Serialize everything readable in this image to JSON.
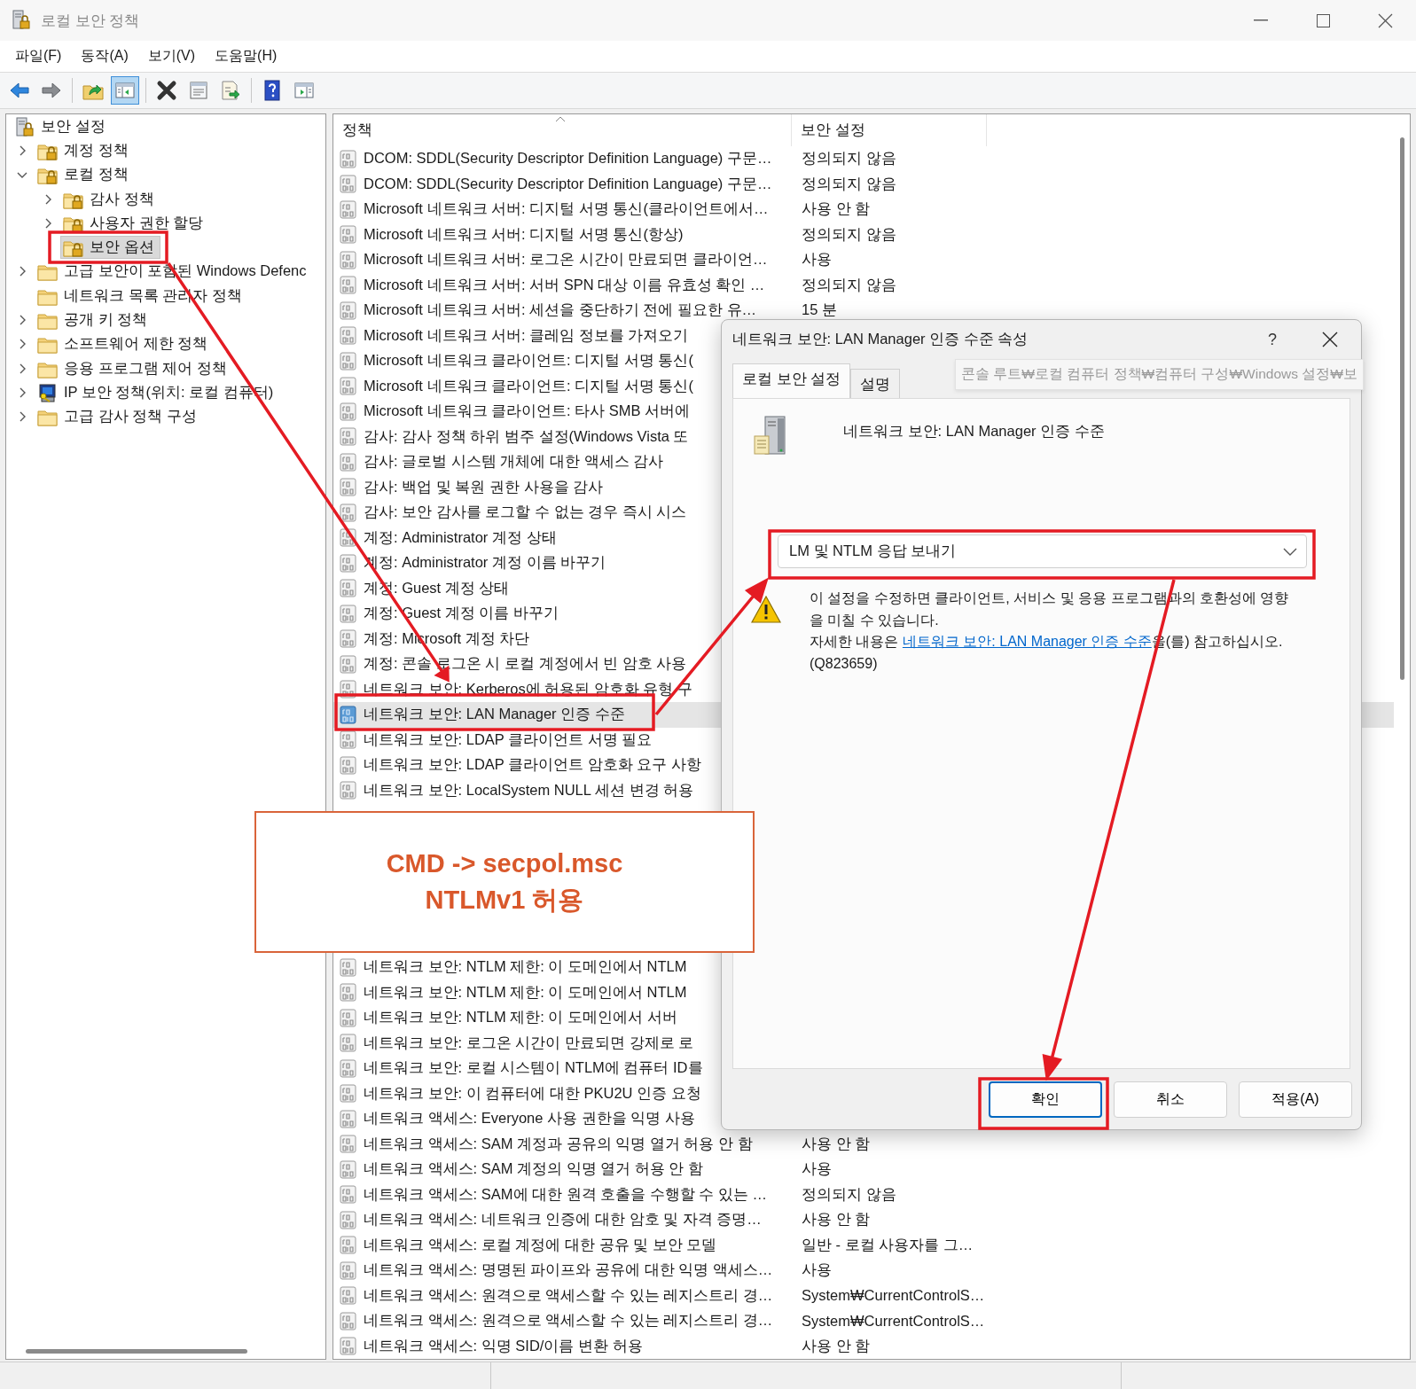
{
  "window": {
    "title": "로컬 보안 정책"
  },
  "menu": [
    "파일(F)",
    "동작(A)",
    "보기(V)",
    "도움말(H)"
  ],
  "toolbar": [
    [
      {
        "kind": "back",
        "pressed": false
      },
      {
        "kind": "forward",
        "pressed": false
      }
    ],
    [
      {
        "kind": "up",
        "pressed": false
      },
      {
        "kind": "tree",
        "pressed": true
      }
    ],
    [
      {
        "kind": "delete",
        "pressed": false
      },
      {
        "kind": "properties",
        "pressed": false
      },
      {
        "kind": "export",
        "pressed": false
      }
    ],
    [
      {
        "kind": "help",
        "pressed": false
      },
      {
        "kind": "pane",
        "pressed": false
      }
    ]
  ],
  "tree": {
    "label": "보안 설정",
    "kind": "server-lock",
    "selected": false,
    "children": [
      {
        "label": "계정 정책",
        "kind": "lock-folder",
        "expanded": false,
        "selected": false
      },
      {
        "label": "로컬 정책",
        "kind": "lock-folder",
        "expanded": true,
        "selected": false,
        "children": [
          {
            "label": "감사 정책",
            "kind": "lock-folder",
            "expanded": false,
            "selected": false
          },
          {
            "label": "사용자 권한 할당",
            "kind": "lock-folder",
            "expanded": false,
            "selected": false
          },
          {
            "label": "보안 옵션",
            "kind": "lock-folder",
            "selected": true
          }
        ]
      },
      {
        "label": "고급 보안이 포함된 Windows Defenc",
        "kind": "folder",
        "expanded": false,
        "selected": false
      },
      {
        "label": "네트워크 목록 관리자 정책",
        "kind": "folder",
        "selected": false
      },
      {
        "label": "공개 키 정책",
        "kind": "folder",
        "expanded": false,
        "selected": false
      },
      {
        "label": "소프트웨어 제한 정책",
        "kind": "folder",
        "expanded": false,
        "selected": false
      },
      {
        "label": "응용 프로그램 제어 정책",
        "kind": "folder",
        "expanded": false,
        "selected": false
      },
      {
        "label": "IP 보안 정책(위치: 로컬 컴퓨터)",
        "kind": "ip-policy",
        "expanded": false,
        "selected": false
      },
      {
        "label": "고급 감사 정책 구성",
        "kind": "folder",
        "expanded": false,
        "selected": false
      }
    ]
  },
  "list": {
    "columns": [
      "정책",
      "보안 설정"
    ],
    "rows_top": [
      {
        "policy": "DCOM: SDDL(Security Descriptor Definition Language) 구문…",
        "setting": "정의되지 않음",
        "selected": false
      },
      {
        "policy": "DCOM: SDDL(Security Descriptor Definition Language) 구문…",
        "setting": "정의되지 않음",
        "selected": false
      },
      {
        "policy": "Microsoft 네트워크 서버: 디지털 서명 통신(클라이언트에서…",
        "setting": "사용 안 함",
        "selected": false
      },
      {
        "policy": "Microsoft 네트워크 서버: 디지털 서명 통신(항상)",
        "setting": "정의되지 않음",
        "selected": false
      },
      {
        "policy": "Microsoft 네트워크 서버: 로그온 시간이 만료되면 클라이언…",
        "setting": "사용",
        "selected": false
      },
      {
        "policy": "Microsoft 네트워크 서버: 서버 SPN 대상 이름 유효성 확인 …",
        "setting": "정의되지 않음",
        "selected": false
      },
      {
        "policy": "Microsoft 네트워크 서버: 세션을 중단하기 전에 필요한 유…",
        "setting": "15 분",
        "selected": false
      },
      {
        "policy": "Microsoft 네트워크 서버: 클레임 정보를 가져오기",
        "selected": false
      },
      {
        "policy": "Microsoft 네트워크 클라이언트: 디지털 서명 통신(",
        "selected": false
      },
      {
        "policy": "Microsoft 네트워크 클라이언트: 디지털 서명 통신(",
        "selected": false
      },
      {
        "policy": "Microsoft 네트워크 클라이언트: 타사 SMB 서버에",
        "selected": false
      },
      {
        "policy": "감사: 감사 정책 하위 범주 설정(Windows Vista 또",
        "selected": false
      },
      {
        "policy": "감사: 글로벌 시스템 개체에 대한 액세스 감사",
        "selected": false
      },
      {
        "policy": "감사: 백업 및 복원 권한 사용을 감사",
        "selected": false
      },
      {
        "policy": "감사: 보안 감사를 로그할 수 없는 경우 즉시 시스",
        "selected": false
      },
      {
        "policy": "계정: Administrator 계정 상태",
        "selected": false
      },
      {
        "policy": "계정: Administrator 계정 이름 바꾸기",
        "selected": false
      },
      {
        "policy": "계정: Guest 계정 상태",
        "selected": false
      },
      {
        "policy": "계정: Guest 계정 이름 바꾸기",
        "selected": false
      },
      {
        "policy": "계정: Microsoft 계정 차단",
        "selected": false
      },
      {
        "policy": "계정: 콘솔 로그온 시 로컬 계정에서 빈 암호 사용",
        "selected": false
      },
      {
        "policy": "네트워크 보안: Kerberos에 허용된 암호화 유형 구",
        "selected": false
      },
      {
        "policy": "네트워크 보안: LAN Manager 인증 수준",
        "selected": true
      },
      {
        "policy": "네트워크 보안: LDAP 클라이언트 서명 필요",
        "selected": false
      },
      {
        "policy": "네트워크 보안: LDAP 클라이언트 암호화 요구 사항",
        "selected": false
      },
      {
        "policy": "네트워크 보안: LocalSystem NULL 세션 변경 허용",
        "selected": false
      }
    ],
    "rows_bottom": [
      {
        "policy": "네트워크 보안: NTLM 제한: 이 도메인에서 NTLM",
        "selected": false
      },
      {
        "policy": "네트워크 보안: NTLM 제한: 이 도메인에서 NTLM",
        "selected": false
      },
      {
        "policy": "네트워크 보안: NTLM 제한: 이 도메인에서 서버",
        "selected": false
      },
      {
        "policy": "네트워크 보안: 로그온 시간이 만료되면 강제로 로",
        "selected": false
      },
      {
        "policy": "네트워크 보안: 로컬 시스템이 NTLM에 컴퓨터 ID를",
        "selected": false
      },
      {
        "policy": "네트워크 보안: 이 컴퓨터에 대한 PKU2U 인증 요청",
        "selected": false
      },
      {
        "policy": "네트워크 액세스: Everyone 사용 권한을 익명 사용",
        "selected": false
      },
      {
        "policy": "네트워크 액세스: SAM 계정과 공유의 익명 열거 허용 안 함",
        "setting": "사용 안 함",
        "selected": false
      },
      {
        "policy": "네트워크 액세스: SAM 계정의 익명 열거 허용 안 함",
        "setting": "사용",
        "selected": false
      },
      {
        "policy": "네트워크 액세스: SAM에 대한 원격 호출을 수행할 수 있는 …",
        "setting": "정의되지 않음",
        "selected": false
      },
      {
        "policy": "네트워크 액세스: 네트워크 인증에 대한 암호 및 자격 증명…",
        "setting": "사용 안 함",
        "selected": false
      },
      {
        "policy": "네트워크 액세스: 로컬 계정에 대한 공유 및 보안 모델",
        "setting": "일반 - 로컬 사용자를 그…",
        "selected": false
      },
      {
        "policy": "네트워크 액세스: 명명된 파이프와 공유에 대한 익명 액세스…",
        "setting": "사용",
        "selected": false
      },
      {
        "policy": "네트워크 액세스: 원격으로 액세스할 수 있는 레지스트리 경…",
        "setting": "System₩CurrentControlS…",
        "selected": false
      },
      {
        "policy": "네트워크 액세스: 원격으로 액세스할 수 있는 레지스트리 경…",
        "setting": "System₩CurrentControlS…",
        "selected": false
      },
      {
        "policy": "네트워크 액세스: 익명 SID/이름 변환 허용",
        "setting": "사용 안 함",
        "selected": false
      }
    ]
  },
  "dialog": {
    "title": "네트워크 보안: LAN Manager 인증 수준 속성",
    "help": "?",
    "tabs": [
      {
        "label": "로컬 보안 설정",
        "selected": true
      },
      {
        "label": "설명",
        "selected": false
      }
    ],
    "path_tooltip": "콘솔 루트₩로컬 컴퓨터 정책₩컴퓨터 구성₩Windows 설정₩보",
    "heading": "네트워크 보안: LAN Manager 인증 수준",
    "dropdown": {
      "value": "LM 및 NTLM 응답 보내기"
    },
    "warning": "이 설정을 수정하면 클라이언트, 서비스 및 응용 프로그램과의 호환성에 영향을 미칠 수 있습니다.",
    "info": {
      "before": "자세한 내용은 ",
      "link": "네트워크 보안: LAN Manager 인증 수준",
      "after": "을(를) 참고하십시오. (Q823659)"
    },
    "buttons": [
      {
        "label": "확인",
        "default": true
      },
      {
        "label": "취소",
        "default": false
      },
      {
        "label": "적용(A)",
        "default": false
      }
    ]
  },
  "callout": {
    "lines": [
      "CMD -> secpol.msc",
      "NTLMv1 허용"
    ]
  }
}
